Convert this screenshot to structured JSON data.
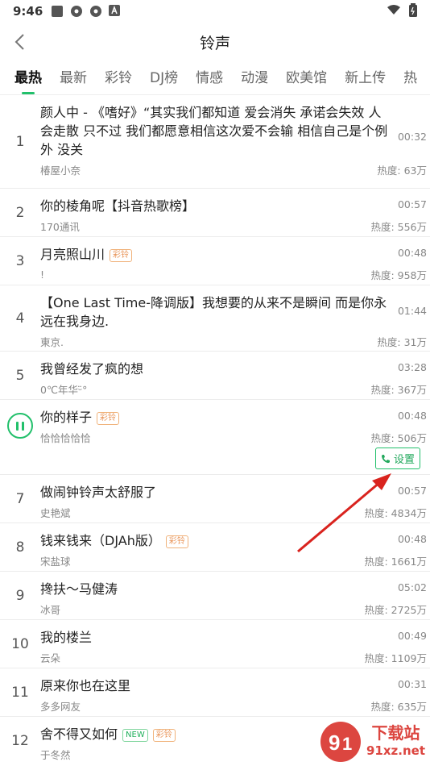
{
  "statusbar": {
    "time": "9:46"
  },
  "header": {
    "title": "铃声",
    "back_label": "<"
  },
  "tabs": [
    "最热",
    "最新",
    "彩铃",
    "DJ榜",
    "情感",
    "动漫",
    "欧美馆",
    "新上传",
    "热"
  ],
  "songs": [
    {
      "index": "1",
      "title": "颜人中 - 《嗜好》“其实我们都知道 爱会消失 承诺会失效 人会走散 只不过 我们都愿意相信这次爱不会输 相信自己是个例外 没关",
      "artist": "椿屋小奈",
      "duration": "00:32",
      "heat": "热度: 63万"
    },
    {
      "index": "2",
      "title": "你的棱角呢【抖音热歌榜】",
      "artist": "170通讯",
      "duration": "00:57",
      "heat": "热度: 556万"
    },
    {
      "index": "3",
      "title": "月亮照山川",
      "tag": "彩铃",
      "artist": "!",
      "duration": "00:48",
      "heat": "热度: 958万"
    },
    {
      "index": "4",
      "title": "【One Last Time-降调版】我想要的从来不是瞬间 而是你永远在我身边.",
      "artist": "東京.",
      "duration": "01:44",
      "heat": "热度: 31万"
    },
    {
      "index": "5",
      "title": "我曾经发了疯的想",
      "artist": "0℃年华ᵕ̈°",
      "duration": "03:28",
      "heat": "热度: 367万"
    },
    {
      "index": "",
      "title": "你的样子",
      "tag": "彩铃",
      "artist": "恰恰恰恰恰",
      "duration": "00:48",
      "heat": "热度: 506万",
      "playing": true,
      "set_label": "设置"
    },
    {
      "index": "7",
      "title": "做闹钟铃声太舒服了",
      "artist": "史艳斌",
      "duration": "00:57",
      "heat": "热度: 4834万"
    },
    {
      "index": "8",
      "title": "钱来钱来（DJAh版）",
      "tag": "彩铃",
      "artist": "宋盐球",
      "duration": "00:48",
      "heat": "热度: 1661万"
    },
    {
      "index": "9",
      "title": "搀扶～马健涛",
      "artist": "冰哥",
      "duration": "05:02",
      "heat": "热度: 2725万"
    },
    {
      "index": "10",
      "title": "我的楼兰",
      "artist": "云朵",
      "duration": "00:49",
      "heat": "热度: 1109万"
    },
    {
      "index": "11",
      "title": "原来你也在这里",
      "artist": "多多网友",
      "duration": "00:31",
      "heat": "热度: 635万"
    },
    {
      "index": "12",
      "title": "舍不得又如何",
      "new_tag": "NEW",
      "tag": "彩铃",
      "artist": "于冬然",
      "duration": "",
      "heat": ""
    }
  ],
  "watermark": {
    "text": "下载站",
    "url": "91xz.net"
  },
  "colors": {
    "accent": "#22c06b",
    "arrow": "#d9231e"
  }
}
